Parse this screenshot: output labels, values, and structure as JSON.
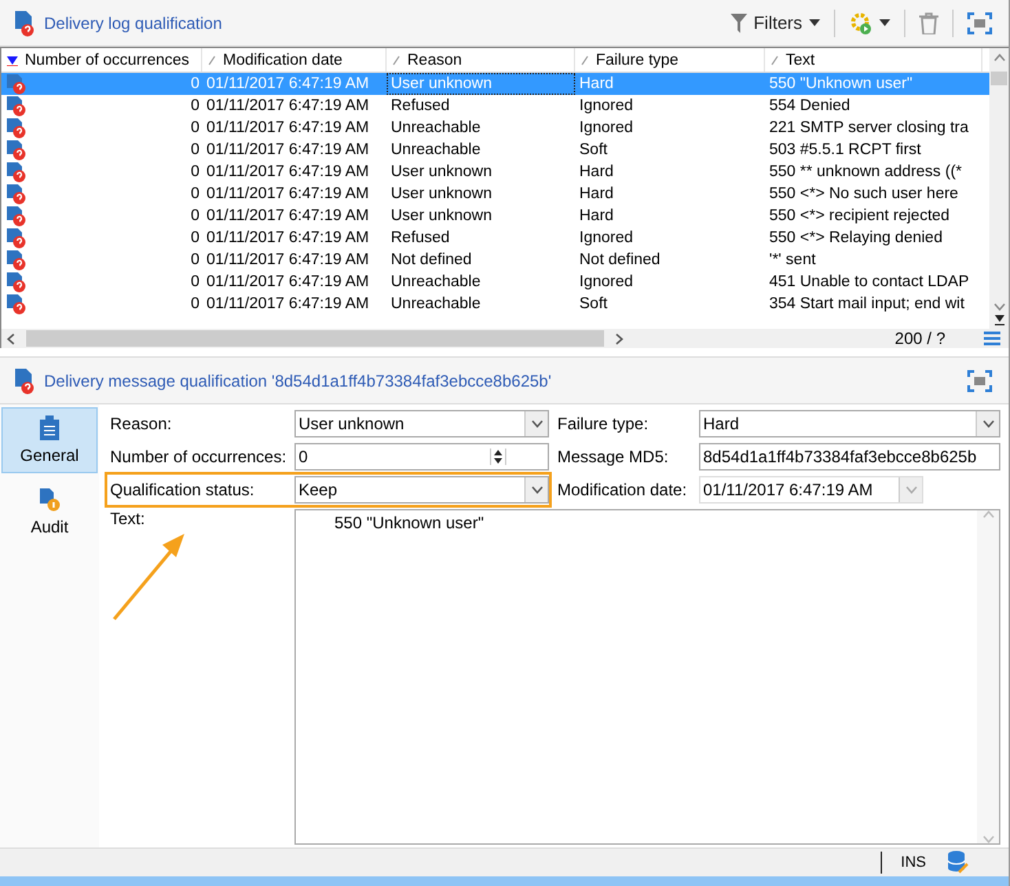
{
  "log_panel": {
    "title": "Delivery log qualification",
    "filters": "Filters",
    "columns": [
      {
        "label": "Number of occurrences",
        "sorted": true
      },
      {
        "label": "Modification date",
        "sorted": false
      },
      {
        "label": "Reason",
        "sorted": false
      },
      {
        "label": "Failure type",
        "sorted": false
      },
      {
        "label": "Text",
        "sorted": false
      }
    ],
    "rows": [
      {
        "count": "0",
        "date": "01/11/2017 6:47:19 AM",
        "reason": "User unknown",
        "failure_type": "Hard",
        "text": "550 \"Unknown user\"",
        "selected": true
      },
      {
        "count": "0",
        "date": "01/11/2017 6:47:19 AM",
        "reason": "Refused",
        "failure_type": "Ignored",
        "text": "554 Denied",
        "selected": false
      },
      {
        "count": "0",
        "date": "01/11/2017 6:47:19 AM",
        "reason": "Unreachable",
        "failure_type": "Ignored",
        "text": "221 SMTP server closing tra",
        "selected": false
      },
      {
        "count": "0",
        "date": "01/11/2017 6:47:19 AM",
        "reason": "Unreachable",
        "failure_type": "Soft",
        "text": "503 #5.5.1 RCPT first",
        "selected": false
      },
      {
        "count": "0",
        "date": "01/11/2017 6:47:19 AM",
        "reason": "User unknown",
        "failure_type": "Hard",
        "text": "550 ** unknown address ((*",
        "selected": false
      },
      {
        "count": "0",
        "date": "01/11/2017 6:47:19 AM",
        "reason": "User unknown",
        "failure_type": "Hard",
        "text": "550 <*> No such user here",
        "selected": false
      },
      {
        "count": "0",
        "date": "01/11/2017 6:47:19 AM",
        "reason": "User unknown",
        "failure_type": "Hard",
        "text": "550 <*> recipient rejected",
        "selected": false
      },
      {
        "count": "0",
        "date": "01/11/2017 6:47:19 AM",
        "reason": "Refused",
        "failure_type": "Ignored",
        "text": "550 <*> Relaying denied",
        "selected": false
      },
      {
        "count": "0",
        "date": "01/11/2017 6:47:19 AM",
        "reason": "Not defined",
        "failure_type": "Not defined",
        "text": "'*' sent",
        "selected": false
      },
      {
        "count": "0",
        "date": "01/11/2017 6:47:19 AM",
        "reason": "Unreachable",
        "failure_type": "Ignored",
        "text": "451 Unable to contact LDAP",
        "selected": false
      },
      {
        "count": "0",
        "date": "01/11/2017 6:47:19 AM",
        "reason": "Unreachable",
        "failure_type": "Soft",
        "text": "354 Start mail input; end wit",
        "selected": false
      }
    ],
    "pager": "200 / ?"
  },
  "message_panel": {
    "title": "Delivery message qualification '8d54d1a1ff4b73384faf3ebcce8b625b'",
    "tabs": [
      {
        "label": "General",
        "selected": true,
        "kind": "clipboard"
      },
      {
        "label": "Audit",
        "selected": false,
        "kind": "audit"
      }
    ],
    "field_rows": [
      [
        {
          "label": "Reason:",
          "value": "User unknown",
          "kind": "combo",
          "highlighted": false
        },
        {
          "label": "Failure type:",
          "value": "Hard",
          "kind": "combo",
          "highlighted": false
        }
      ],
      [
        {
          "label": "Number of occurrences:",
          "value": "0",
          "kind": "spin",
          "highlighted": false
        },
        {
          "label": "Message MD5:",
          "value": "8d54d1a1ff4b73384faf3ebcce8b625b",
          "kind": "text",
          "highlighted": false
        }
      ],
      [
        {
          "label": "Qualification status:",
          "value": "Keep",
          "kind": "combo",
          "highlighted": true
        },
        {
          "label": "Modification date:",
          "value": "01/11/2017 6:47:19 AM",
          "kind": "date",
          "highlighted": false
        }
      ]
    ],
    "text": {
      "label": "Text:",
      "value": "550 \"Unknown user\""
    }
  },
  "status_bar": {
    "mode": "INS"
  }
}
